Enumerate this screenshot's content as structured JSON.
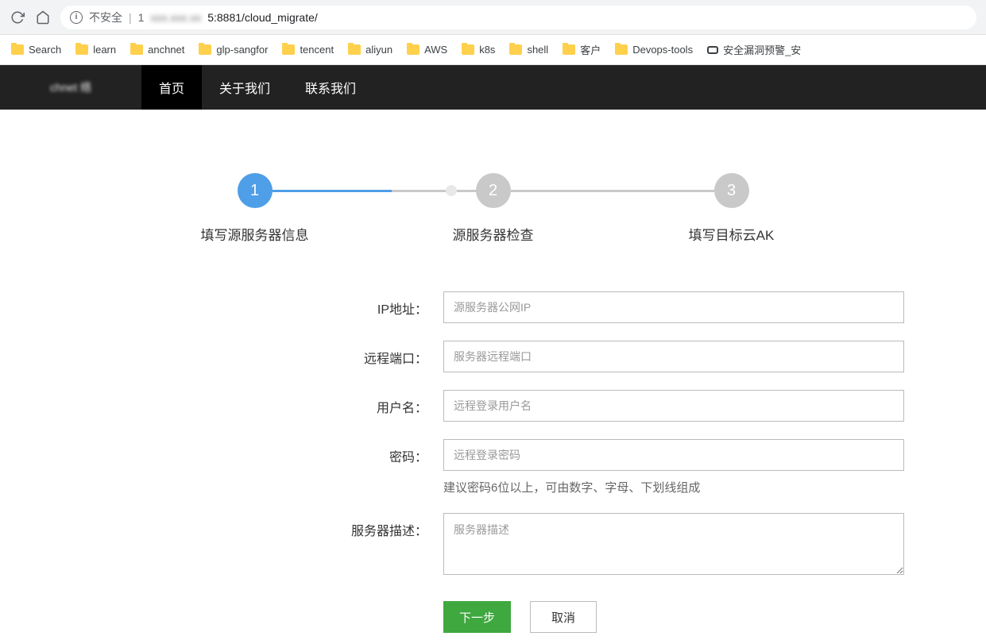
{
  "browser": {
    "insecure_label": "不安全",
    "url_prefix": "1",
    "url_hidden": "xxx.xxx.xx",
    "url_port_path": "5:8881/cloud_migrate/"
  },
  "bookmarks": [
    {
      "label": "Search"
    },
    {
      "label": "learn"
    },
    {
      "label": "anchnet"
    },
    {
      "label": "glp-sangfor"
    },
    {
      "label": "tencent"
    },
    {
      "label": "aliyun"
    },
    {
      "label": "AWS"
    },
    {
      "label": "k8s"
    },
    {
      "label": "shell"
    },
    {
      "label": "客户"
    },
    {
      "label": "Devops-tools"
    }
  ],
  "bookmark_tail": "安全漏洞预警_安",
  "nav": {
    "logo_text": "chnet 络",
    "items": [
      "首页",
      "关于我们",
      "联系我们"
    ]
  },
  "steps": [
    {
      "num": "1",
      "label": "填写源服务器信息"
    },
    {
      "num": "2",
      "label": "源服务器检查"
    },
    {
      "num": "3",
      "label": "填写目标云AK"
    }
  ],
  "form": {
    "ip": {
      "label": "IP地址：",
      "placeholder": "源服务器公网IP"
    },
    "port": {
      "label": "远程端口：",
      "placeholder": "服务器远程端口"
    },
    "user": {
      "label": "用户名：",
      "placeholder": "远程登录用户名"
    },
    "password": {
      "label": "密码：",
      "placeholder": "远程登录密码",
      "hint": "建议密码6位以上，可由数字、字母、下划线组成"
    },
    "desc": {
      "label": "服务器描述：",
      "placeholder": "服务器描述"
    },
    "next": "下一步",
    "cancel": "取消"
  }
}
